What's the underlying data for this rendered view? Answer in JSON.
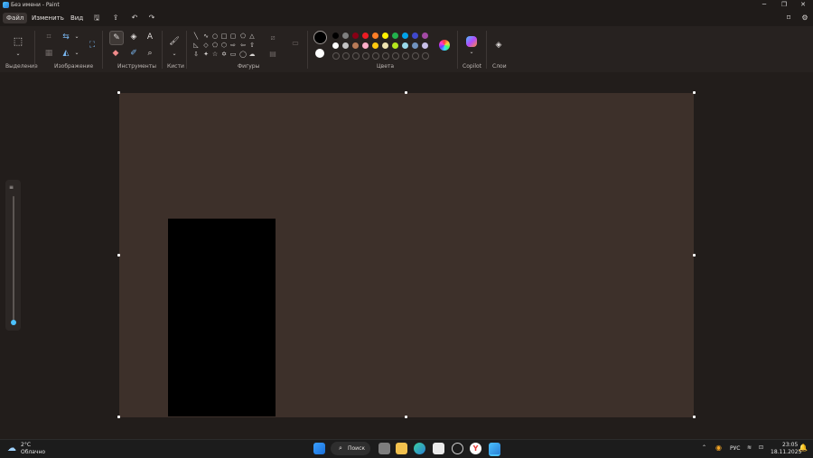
{
  "window": {
    "title": "Без имени - Paint",
    "minimize_icon": "─",
    "maximize_icon": "❐",
    "close_icon": "✕"
  },
  "menu": {
    "items": [
      "Файл",
      "Изменить",
      "Вид"
    ]
  },
  "ribbon": {
    "groups": {
      "selection": "Выделение",
      "image": "Изображение",
      "tools": "Инструменты",
      "brushes": "Кисти",
      "shapes": "Фигуры",
      "colors": "Цвета",
      "copilot": "Copilot",
      "layers": "Слои"
    }
  },
  "colors": {
    "primary": "#000000",
    "secondary": "#ffffff",
    "palette_row1": [
      "#000000",
      "#7f7f7f",
      "#880015",
      "#ed1c24",
      "#ff7f27",
      "#fff200",
      "#22b14c",
      "#00a2e8",
      "#3f48cc",
      "#a349a4"
    ],
    "palette_row2": [
      "#ffffff",
      "#c3c3c3",
      "#b97a57",
      "#ffaec9",
      "#ffc90e",
      "#efe4b0",
      "#b5e61d",
      "#99d9ea",
      "#7092be",
      "#c8bfe7"
    ],
    "canvas_bg": "#3d302a",
    "accent": "#4cc2ff"
  },
  "zoom": {
    "level_fraction": 0.0
  },
  "taskbar": {
    "weather_temp": "2°C",
    "weather_desc": "Облачно",
    "search_label": "Поиск",
    "lang": "РУС",
    "time": "23:05",
    "date": "18.11.2025"
  }
}
